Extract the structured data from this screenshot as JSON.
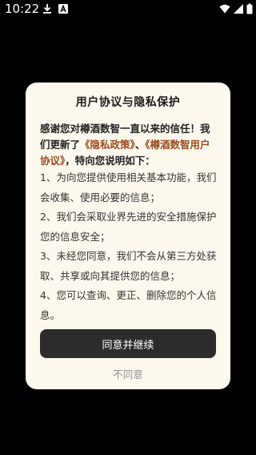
{
  "status_bar": {
    "time": "10:22",
    "icons": [
      "download-icon",
      "a-notification-icon",
      "wifi-icon",
      "signal-icon",
      "battery-icon"
    ]
  },
  "dialog": {
    "title": "用户协议与隐私保护",
    "intro_part1": "感谢您对樽酒数智一直以来的信任！我们更新了",
    "privacy_policy_link": "《隐私政策》",
    "separator": "、",
    "user_agreement_link": "《樽酒数智用户协议》",
    "intro_part2": "，特向您说明如下：",
    "items": [
      "1、为向您提供使用相关基本功能，我们会收集、使用必要的信息；",
      "2、我们会采取业界先进的安全措施保护您的信息安全；",
      "3、未经您同意，我们不会从第三方处获取、共享或向其提供您的信息；",
      "4、您可以查询、更正、删除您的个人信息。"
    ],
    "agree_label": "同意并继续",
    "decline_label": "不同意"
  },
  "colors": {
    "dialog_bg": "#fdf8ee",
    "link": "#9b4a1f",
    "primary_button": "#2d2c2c"
  }
}
